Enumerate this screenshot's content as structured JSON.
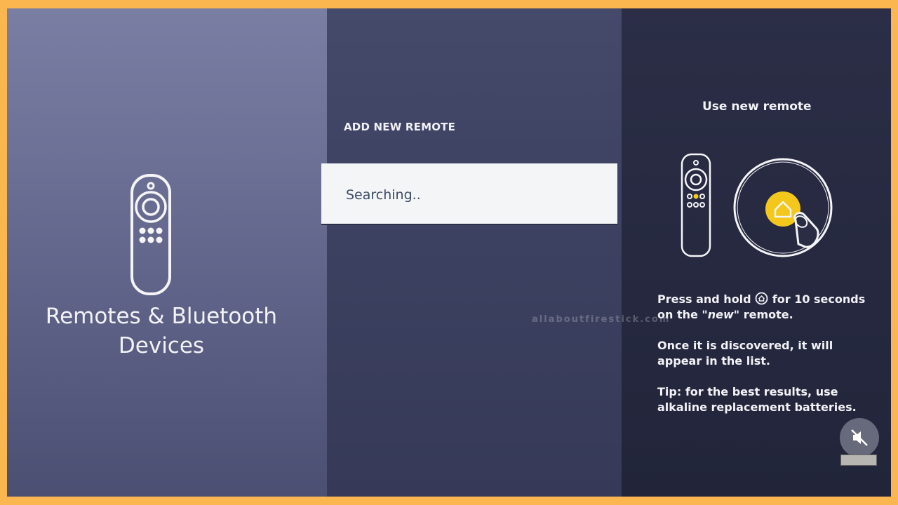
{
  "left_panel": {
    "title": "Remotes & Bluetooth Devices",
    "remote_icon": "fire-tv-remote-icon"
  },
  "middle_panel": {
    "heading": "ADD NEW REMOTE",
    "search_status": "Searching.."
  },
  "right_panel": {
    "heading": "Use new remote",
    "home_button_icon": "home-icon",
    "home_button_color": "#f3c81b",
    "instruction_prefix": "Press and hold",
    "instruction_middle": "for 10 seconds on the",
    "instruction_new": "\"new\"",
    "instruction_suffix": "remote.",
    "discovered_text": "Once it is discovered, it will appear in the list.",
    "tip_text": "Tip: for the best results, use alkaline replacement batteries."
  },
  "watermark": "allaboutfirestick.com",
  "mute_icon": "mute-speaker-icon",
  "colors": {
    "frame": "#fcb64f",
    "search_row_background": "#f4f5f7",
    "search_text": "#3b4b63",
    "accent_yellow": "#f3c81b"
  }
}
